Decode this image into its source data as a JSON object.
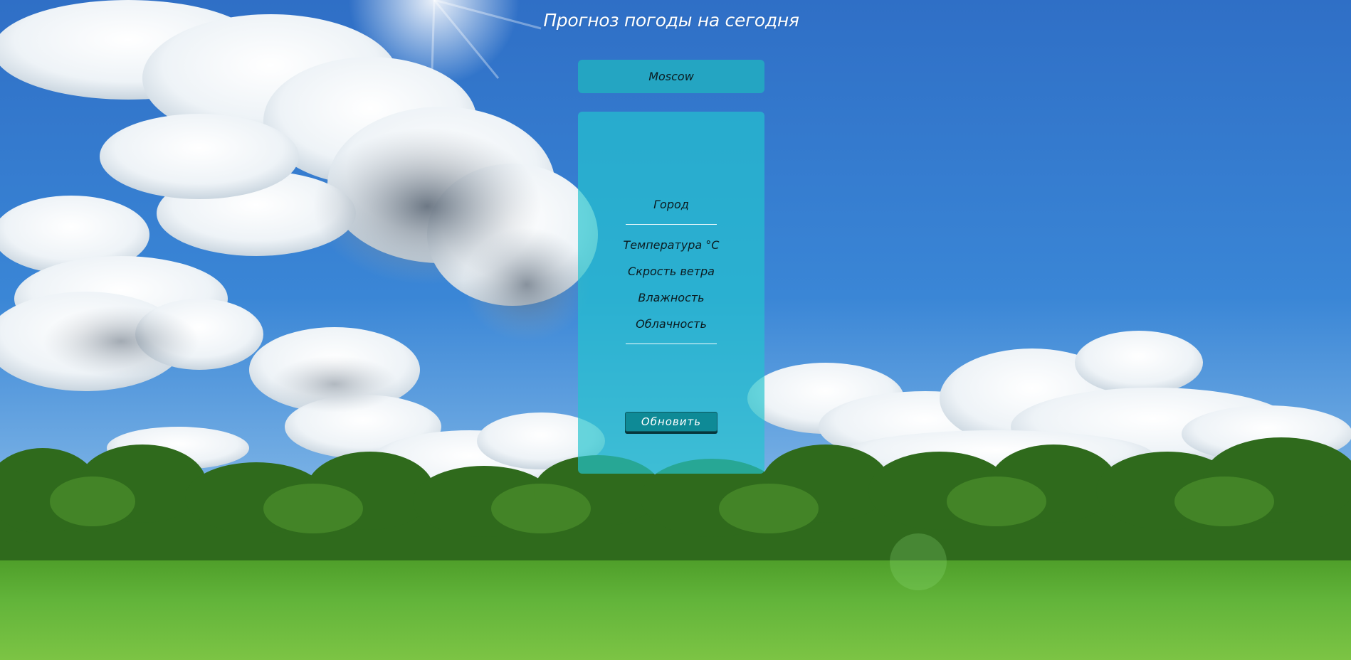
{
  "page": {
    "title": "Прогноз погоды на сегодня"
  },
  "search": {
    "value": "Moscow"
  },
  "weather": {
    "city_label": "Город",
    "temperature_label": "Температура °C",
    "wind_label": "Скрость ветра",
    "humidity_label": "Влажность",
    "cloudiness_label": "Облачность"
  },
  "actions": {
    "refresh_label": "Обновить"
  },
  "colors": {
    "panel": "#22acc0",
    "button": "#0e8a96",
    "sky": "#3b7fd0",
    "grass": "#5fb43a"
  }
}
